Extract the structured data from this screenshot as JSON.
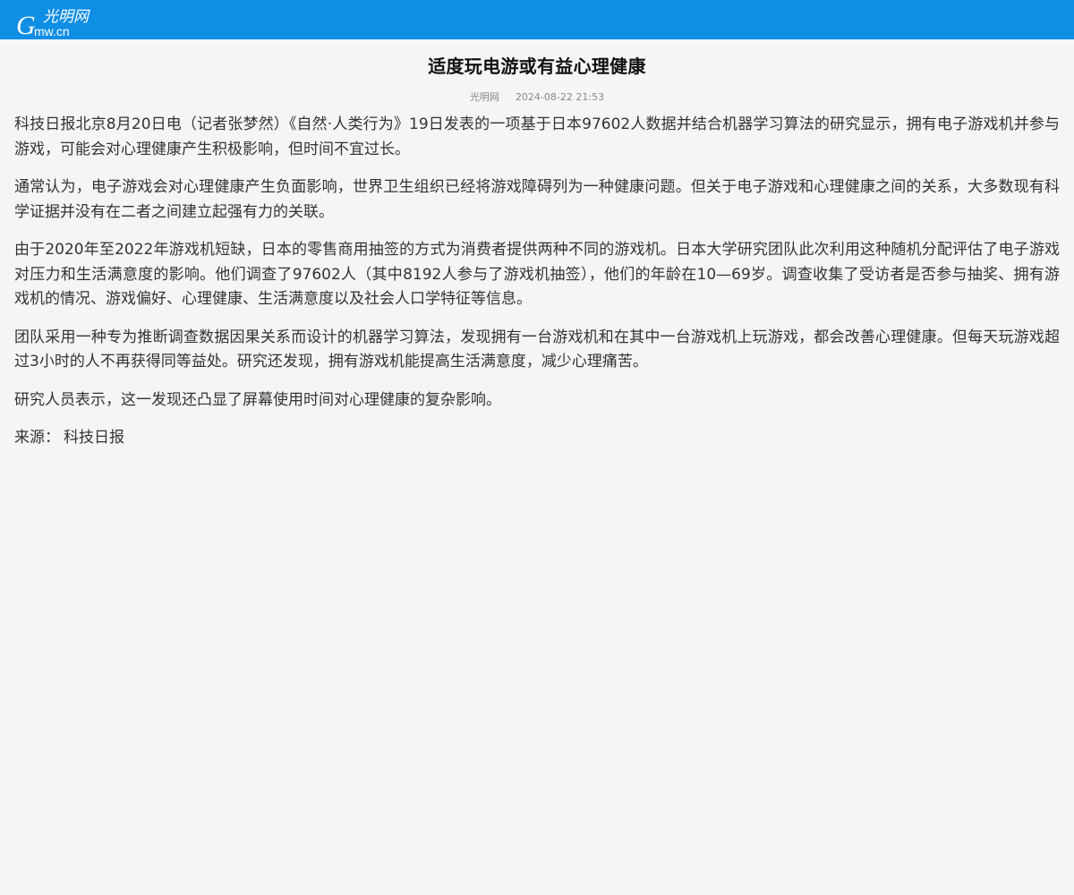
{
  "header": {
    "logo_letter": "G",
    "logo_cn": "光明网",
    "logo_domain": "mw.cn",
    "logo_color": "#ffffff",
    "bar_color": "#0f8ee6"
  },
  "article": {
    "title": "适度玩电游或有益心理健康",
    "source": "光明网",
    "date": "2024-08-22 21:53",
    "paragraphs": [
      "科技日报北京8月20日电（记者张梦然）《自然·人类行为》19日发表的一项基于日本97602人数据并结合机器学习算法的研究显示，拥有电子游戏机并参与游戏，可能会对心理健康产生积极影响，但时间不宜过长。",
      "通常认为，电子游戏会对心理健康产生负面影响，世界卫生组织已经将游戏障碍列为一种健康问题。但关于电子游戏和心理健康之间的关系，大多数现有科学证据并没有在二者之间建立起强有力的关联。",
      "由于2020年至2022年游戏机短缺，日本的零售商用抽签的方式为消费者提供两种不同的游戏机。日本大学研究团队此次利用这种随机分配评估了电子游戏对压力和生活满意度的影响。他们调查了97602人（其中8192人参与了游戏机抽签），他们的年龄在10—69岁。调查收集了受访者是否参与抽奖、拥有游戏机的情况、游戏偏好、心理健康、生活满意度以及社会人口学特征等信息。",
      "团队采用一种专为推断调查数据因果关系而设计的机器学习算法，发现拥有一台游戏机和在其中一台游戏机上玩游戏，都会改善心理健康。但每天玩游戏超过3小时的人不再获得同等益处。研究还发现，拥有游戏机能提高生活满意度，减少心理痛苦。",
      "研究人员表示，这一发现还凸显了屏幕使用时间对心理健康的复杂影响。"
    ],
    "source_label": "来源：",
    "source_value": "科技日报"
  }
}
